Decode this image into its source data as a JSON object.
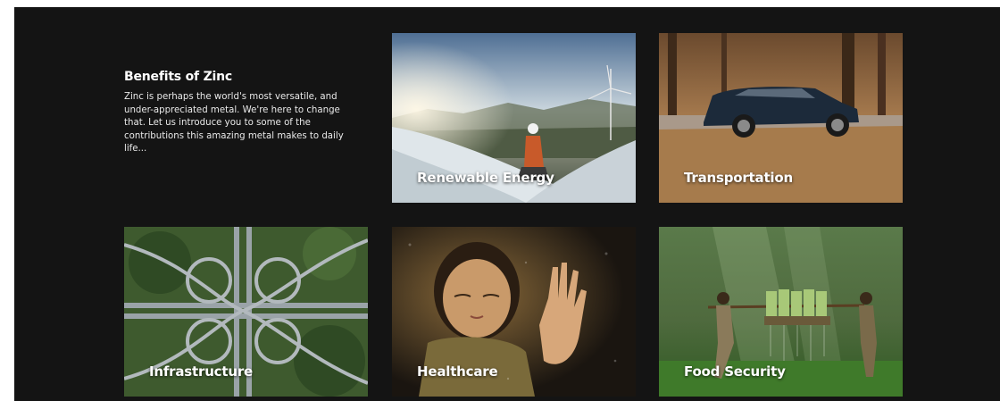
{
  "intro": {
    "title": "Benefits of Zinc",
    "body": "Zinc is perhaps the world's most versatile, and under-appreciated metal. We're here to change that.  Let us introduce you to some of the contributions this amazing metal makes to daily life..."
  },
  "cards": [
    {
      "label": "Renewable Energy"
    },
    {
      "label": "Transportation"
    },
    {
      "label": "Infrastructure"
    },
    {
      "label": "Healthcare"
    },
    {
      "label": "Food Security"
    }
  ],
  "colors": {
    "page_background": "#141414",
    "text": "#ffffff"
  }
}
